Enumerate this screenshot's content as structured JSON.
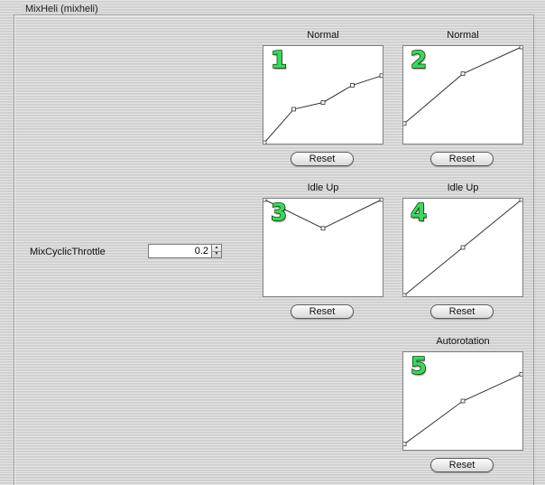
{
  "group": {
    "title": "MixHeli (mixheli)"
  },
  "parameter": {
    "label": "MixCyclicThrottle",
    "value": "0.2"
  },
  "reset_label": "Reset",
  "curves": [
    {
      "title": "Normal",
      "badge": "1",
      "points": [
        [
          0,
          0
        ],
        [
          0.25,
          0.35
        ],
        [
          0.5,
          0.42
        ],
        [
          0.75,
          0.6
        ],
        [
          1,
          0.7
        ]
      ]
    },
    {
      "title": "Normal",
      "badge": "2",
      "points": [
        [
          0,
          0.2
        ],
        [
          0.5,
          0.72
        ],
        [
          1,
          1
        ]
      ]
    },
    {
      "title": "Idle Up",
      "badge": "3",
      "points": [
        [
          0,
          1
        ],
        [
          0.5,
          0.7
        ],
        [
          1,
          1
        ]
      ]
    },
    {
      "title": "Idle Up",
      "badge": "4",
      "points": [
        [
          0,
          0
        ],
        [
          0.5,
          0.5
        ],
        [
          1,
          1
        ]
      ]
    },
    {
      "title": "Autorotation",
      "badge": "5",
      "points": [
        [
          0,
          0.05
        ],
        [
          0.5,
          0.5
        ],
        [
          1,
          0.78
        ]
      ]
    }
  ]
}
